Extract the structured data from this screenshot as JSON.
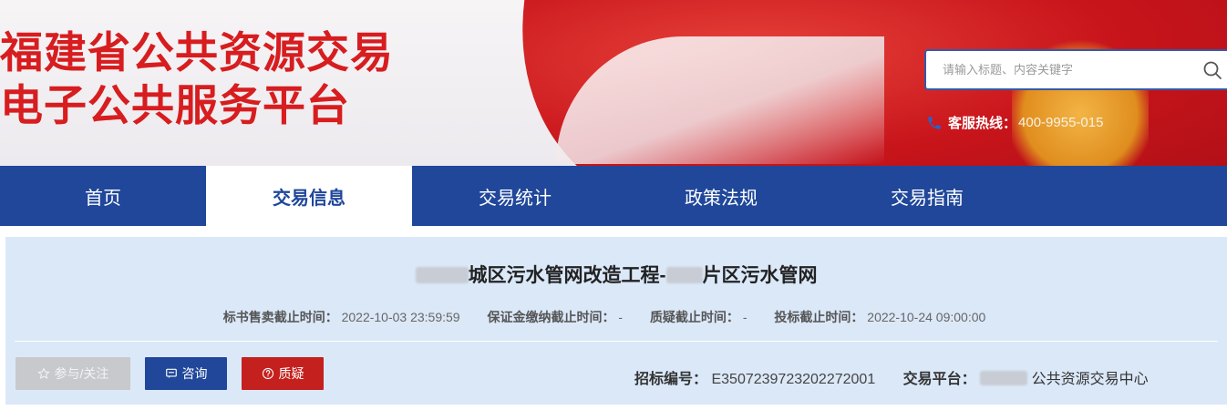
{
  "header": {
    "title_line1": "福建省公共资源交易",
    "title_line2": "电子公共服务平台",
    "search_placeholder": "请输入标题、内容关键字",
    "hotline_label": "客服热线：",
    "hotline_number": "400-9955-015"
  },
  "nav": {
    "items": [
      "首页",
      "交易信息",
      "交易统计",
      "政策法规",
      "交易指南"
    ],
    "active_index": 1
  },
  "project": {
    "title_part1": "城区污水管网改造工程-",
    "title_part2": "片区污水管网",
    "deadlines": [
      {
        "label": "标书售卖截止时间：",
        "value": "2022-10-03 23:59:59"
      },
      {
        "label": "保证金缴纳截止时间：",
        "value": "-"
      },
      {
        "label": "质疑截止时间：",
        "value": "-"
      },
      {
        "label": "投标截止时间：",
        "value": "2022-10-24 09:00:00"
      }
    ],
    "actions": {
      "follow": "参与/关注",
      "consult": "咨询",
      "query": "质疑"
    },
    "tender_no_label": "招标编号：",
    "tender_no": "E3507239723202272001",
    "platform_label": "交易平台：",
    "platform_value": "公共资源交易中心"
  },
  "colors": {
    "brand_red": "#d71d1f",
    "nav_blue": "#20479a",
    "panel_bg": "#dbe8f8",
    "query_red": "#c4201d",
    "follow_gray": "#c7c9cc"
  }
}
